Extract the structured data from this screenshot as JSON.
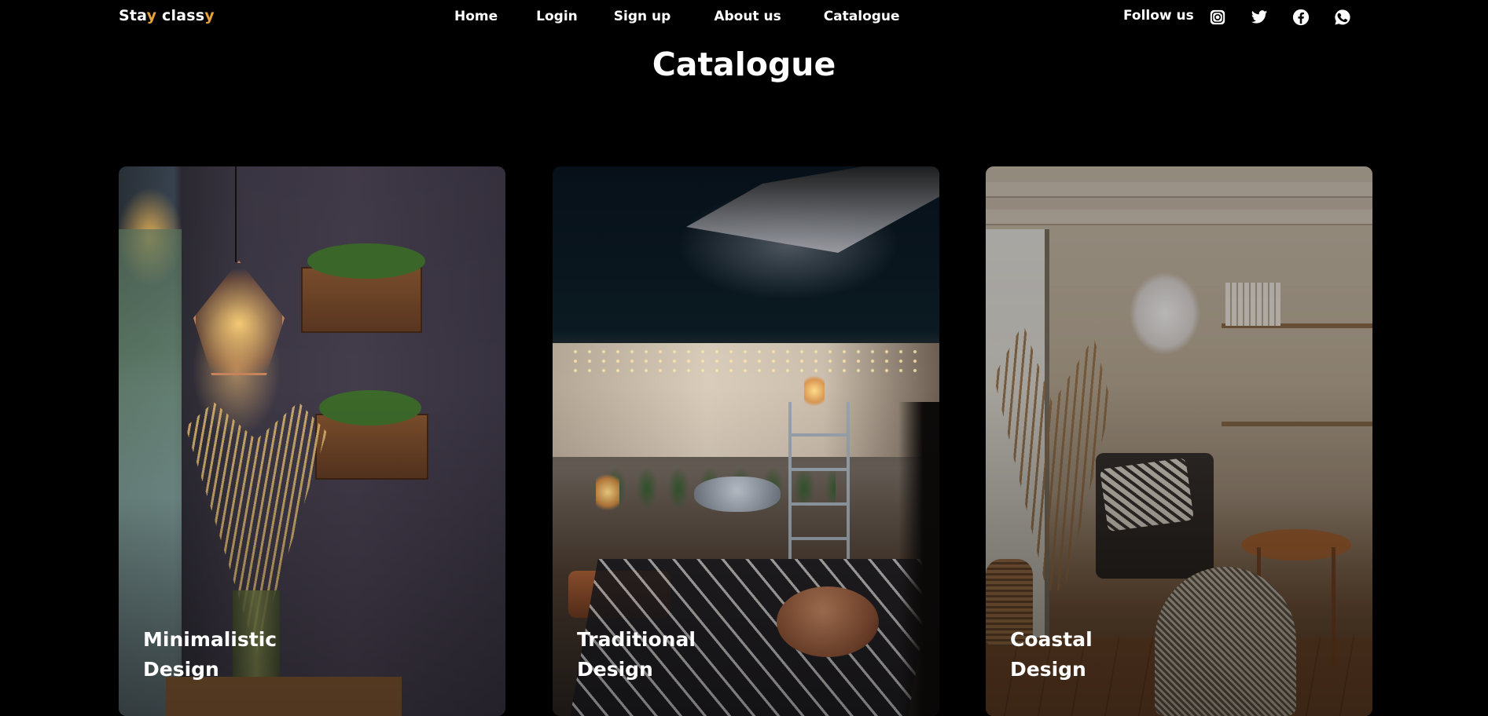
{
  "header": {
    "logo": {
      "part1": "Sta",
      "accent1": "y",
      "part2": " class",
      "accent2": "y"
    },
    "nav": [
      {
        "label": "Home"
      },
      {
        "label": "Login"
      },
      {
        "label": "Sign up"
      },
      {
        "label": "About us"
      },
      {
        "label": "Catalogue"
      }
    ],
    "follow_label": "Follow us",
    "social_icons": [
      "instagram-icon",
      "twitter-icon",
      "facebook-icon",
      "whatsapp-icon"
    ]
  },
  "page": {
    "title": "Catalogue"
  },
  "cards": [
    {
      "line1": "Minimalistic",
      "line2": "Design"
    },
    {
      "line1": "Traditional",
      "line2": "Design"
    },
    {
      "line1": "Coastal",
      "line2": "Design"
    }
  ],
  "colors": {
    "background": "#000000",
    "text": "#ffffff",
    "logo_accent": "#e9a23b"
  }
}
